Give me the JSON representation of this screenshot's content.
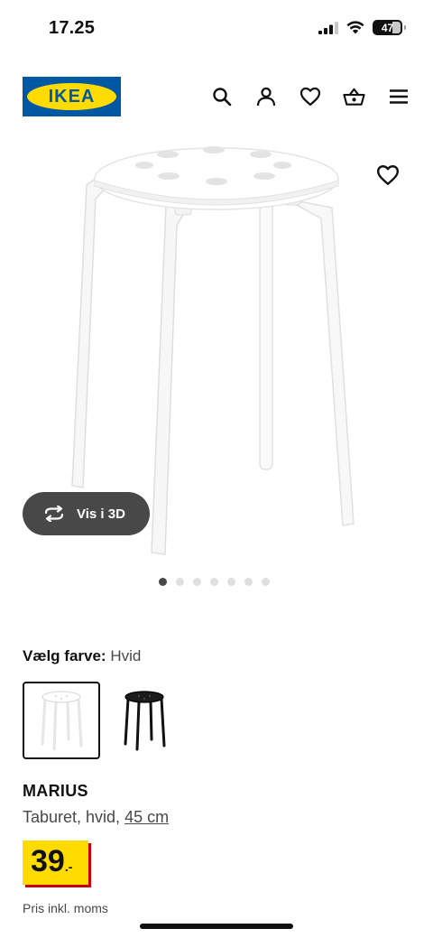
{
  "status_bar": {
    "time": "17.25",
    "battery_level": "47"
  },
  "header": {
    "logo_text": "IKEA",
    "icons": [
      "search-icon",
      "account-icon",
      "heart-icon",
      "basket-icon",
      "menu-icon"
    ]
  },
  "gallery": {
    "view_3d_label": "Vis i 3D",
    "image_count": 7,
    "active_index": 0
  },
  "color_selector": {
    "label": "Vælg farve:",
    "selected_value": "Hvid",
    "swatches": [
      "white",
      "black"
    ]
  },
  "product": {
    "name": "MARIUS",
    "description": "Taburet, hvid,",
    "size_link": "45 cm",
    "price_integer": "39",
    "price_suffix": ".-",
    "price_note": "Pris inkl. moms"
  },
  "colors": {
    "ikea_blue": "#0058a3",
    "ikea_yellow": "#ffdb00",
    "price_red": "#cc0008",
    "button_dark": "#484848"
  }
}
